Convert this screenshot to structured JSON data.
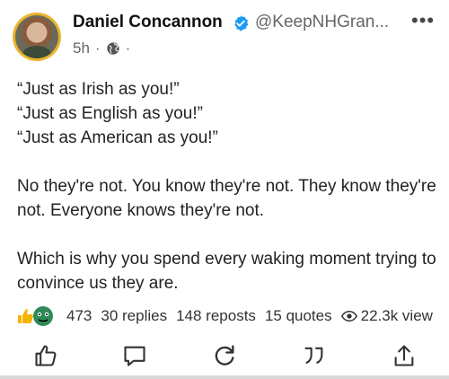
{
  "post": {
    "author_name": "Daniel Concannon",
    "handle": "@KeepNHGran...",
    "time": "5h",
    "dot": "·",
    "paragraphs": [
      [
        "“Just as Irish as you!”",
        "“Just as English as you!”",
        "“Just as American as you!”"
      ],
      [
        "No they're not. You know they're not. They know they're not. Everyone knows they're not."
      ],
      [
        "Which is why you spend every waking moment trying to convince us they are."
      ]
    ]
  },
  "stats": {
    "reactions": "473",
    "replies": "30 replies",
    "reposts": "148 reposts",
    "quotes": "15 quotes",
    "views": "22.3k view"
  },
  "icons": {
    "verified": "verified-badge-icon",
    "globe": "globe-icon",
    "more": "more-options-icon",
    "like": "thumbs-up-icon",
    "reply": "comment-icon",
    "repost": "repost-icon",
    "quote": "quote-icon",
    "share": "share-icon"
  },
  "colors": {
    "verified": "#1d9bf0",
    "avatar_ring": "#e9b52b",
    "text": "#222222",
    "muted": "#666666"
  }
}
